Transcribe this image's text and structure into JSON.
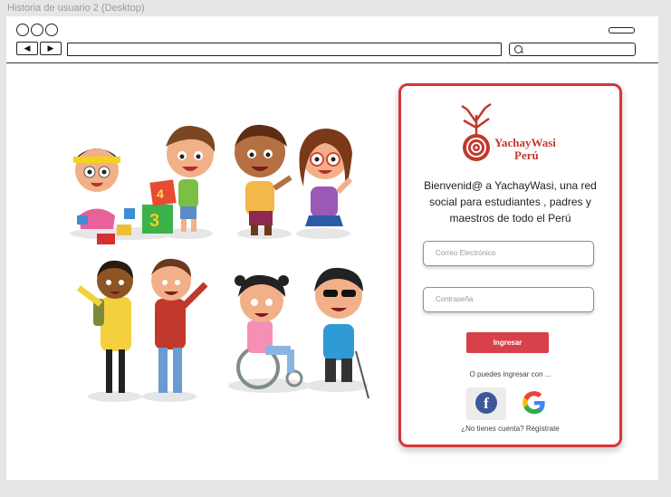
{
  "wireframe": {
    "title": "Historia de usuario 2 (Desktop)"
  },
  "browser": {
    "back_label": "◀",
    "forward_label": "▶",
    "url_value": "",
    "search_value": ""
  },
  "card": {
    "brand": {
      "name": "YachayWasi",
      "country": "Perú"
    },
    "welcome_text": "Bienvenid@ a YachayWasi, una red social para estudiantes , padres y maestros de todo el Perú",
    "email_placeholder": "Correo Electrónico",
    "password_placeholder": "Contraseña",
    "login_label": "Ingresar",
    "alternative_text": "O puedes ingresar con ...",
    "facebook_letter": "f",
    "signup_text": "¿No tienes cuenta? Regístrate"
  },
  "colors": {
    "accent": "#d7353a",
    "button": "#d8414a",
    "facebook": "#3b5998",
    "background": "#e6e6e6"
  },
  "icons": [
    "back-arrow-icon",
    "forward-arrow-icon",
    "search-icon",
    "menu-icon",
    "brand-logo-icon",
    "facebook-icon",
    "google-icon"
  ]
}
